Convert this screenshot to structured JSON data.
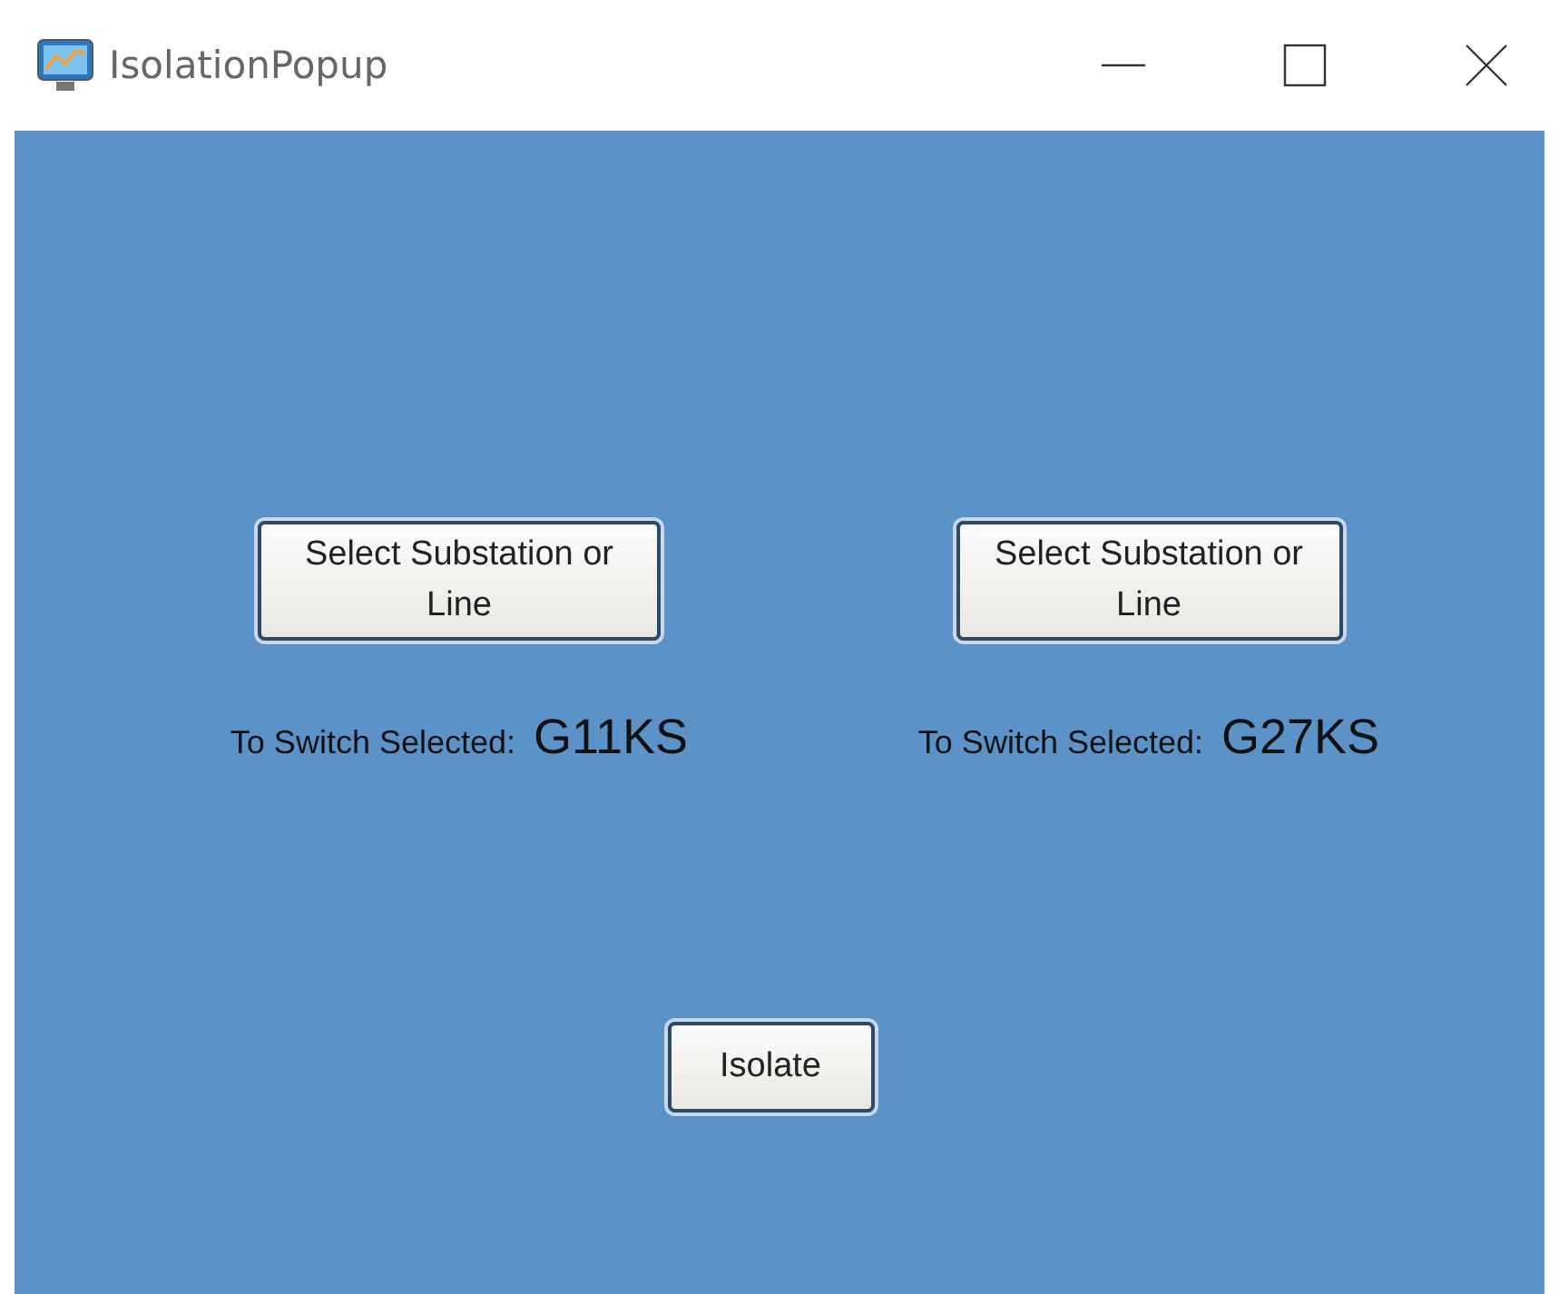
{
  "window": {
    "title": "IsolationPopup"
  },
  "selectors": [
    {
      "button": "Select Substation or Line",
      "label": "To Switch Selected:",
      "value": "G11KS"
    },
    {
      "button": "Select Substation or Line",
      "label": "To Switch Selected:",
      "value": "G27KS"
    }
  ],
  "action_button": "Isolate"
}
